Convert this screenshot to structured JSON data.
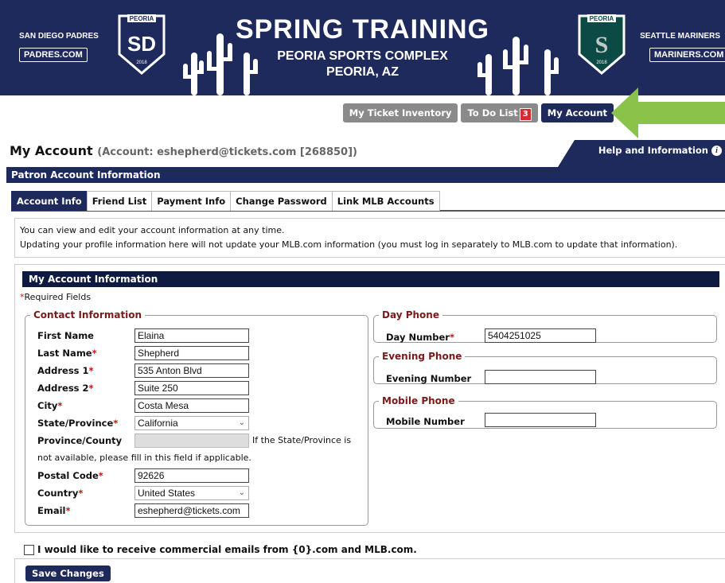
{
  "banner": {
    "left_team": "SAN DIEGO PADRES",
    "left_site": "PADRES.COM",
    "right_team": "SEATTLE MARINERS",
    "right_site": "MARINERS.COM",
    "title": "SPRING TRAINING",
    "venue": "PEORIA SPORTS COMPLEX",
    "city": "PEORIA, AZ",
    "left_logo": {
      "top": "PEORIA",
      "letters": "SD",
      "year": "2018"
    },
    "right_logo": {
      "top": "PEORIA",
      "letters": "S",
      "year": "2018"
    }
  },
  "topnav": {
    "ticket_inventory": "My Ticket Inventory",
    "todo_list": "To Do List",
    "todo_count": "3",
    "my_account": "My Account"
  },
  "page": {
    "title": "My Account",
    "account": "(Account: eshepherd@tickets.com [268850])",
    "help": "Help and Information",
    "section": "Patron Account Information"
  },
  "tabs": [
    "Account Info",
    "Friend List",
    "Payment Info",
    "Change Password",
    "Link MLB Accounts"
  ],
  "intro": {
    "line1": "You can view and edit your account information at any time.",
    "line2": "Updating your profile information here will not update your MLB.com information (you must log in separately to MLB.com to update that information)."
  },
  "account_info": {
    "header": "My Account Information",
    "required_note": "Required Fields",
    "contact_legend": "Contact Information",
    "first_name_label": "First Name",
    "first_name": "Elaina",
    "last_name_label": "Last Name",
    "last_name": "Shepherd",
    "address1_label": "Address 1",
    "address1": "535 Anton Blvd",
    "address2_label": "Address 2",
    "address2": "Suite 250",
    "city_label": "City",
    "city": "Costa Mesa",
    "state_label": "State/Province",
    "state": "California",
    "province_label": "Province/County",
    "province": "",
    "province_note_a": "If the State/Province is",
    "province_note_b": "not available, please fill in this field if applicable.",
    "postal_label": "Postal Code",
    "postal": "92626",
    "country_label": "Country",
    "country": "United States",
    "email_label": "Email",
    "email": "eshepherd@tickets.com",
    "day_legend": "Day Phone",
    "day_label": "Day Number",
    "day_value": "5404251025",
    "evening_legend": "Evening Phone",
    "evening_label": "Evening Number",
    "evening_value": "",
    "mobile_legend": "Mobile Phone",
    "mobile_label": "Mobile Number",
    "mobile_value": ""
  },
  "optin": "I would like to receive commercial emails from {0}.com and MLB.com.",
  "save": "Save Changes",
  "colors": {
    "navy": "#1f2a5c",
    "arrow_green": "#8bc34a",
    "required_red": "#cc1111",
    "legend_red": "#7a1a1a"
  }
}
